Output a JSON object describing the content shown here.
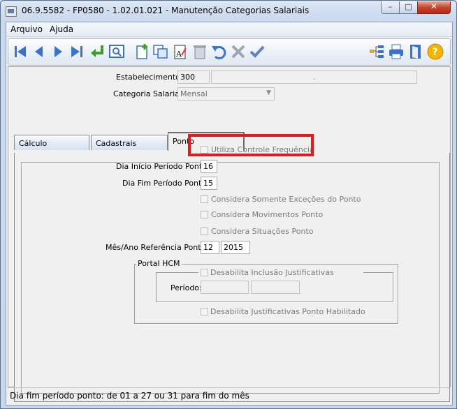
{
  "window": {
    "title": "06.9.5582 - FP0580 - 1.02.01.021 - Manutenção Categorias Salariais",
    "minimize": "–",
    "maximize": "□",
    "close": "✕"
  },
  "menu": {
    "items": [
      "Arquivo",
      "Ajuda"
    ]
  },
  "toolbar": {
    "icons": [
      "first-icon",
      "previous-icon",
      "next-icon",
      "last-icon",
      "goto-icon",
      "zoom-icon",
      "add-icon",
      "copy-icon",
      "edit-icon",
      "delete-icon",
      "undo-icon",
      "cancel-icon",
      "save-icon",
      "tree-icon",
      "print-icon",
      "exit-icon",
      "help-icon"
    ],
    "help_label": "?"
  },
  "header": {
    "estabelecimento_label": "Estabelecimento:",
    "estabelecimento_code": "300",
    "estabelecimento_name": ".",
    "categoria_label": "Categoria Salarial:",
    "categoria_value": "Mensal"
  },
  "tabs": [
    {
      "label": "Cálculo"
    },
    {
      "label": "Cadastrais"
    },
    {
      "label": "Ponto"
    }
  ],
  "ponto": {
    "utiliza_controle": "Utiliza Controle Frequência",
    "dia_inicio_label": "Dia Início Período Ponto:",
    "dia_inicio_value": "16",
    "dia_fim_label": "Dia Fim Período Ponto:",
    "dia_fim_value": "15",
    "somente_excecoes": "Considera Somente Exceções do Ponto",
    "movimentos": "Considera Movimentos Ponto",
    "situacoes": "Considera Situações Ponto",
    "mes_ano_label": "Mês/Ano Referência Ponto:",
    "mes_value": "12",
    "ano_value": "2015",
    "portal": {
      "legend": "Portal HCM",
      "desabilita_inclusao": "Desabilita Inclusão Justificativas",
      "periodo_label": "Período:",
      "periodo_inicio": "",
      "periodo_fim": "",
      "desabilita_justificativas": "Desabilita Justificativas Ponto Habilitado"
    }
  },
  "status": {
    "text": "Dia fim período ponto: de 01 a 27 ou 31 para fim do mês"
  },
  "colors": {
    "highlight": "#e21b23",
    "toolbar_blue": "#3a73c8"
  }
}
